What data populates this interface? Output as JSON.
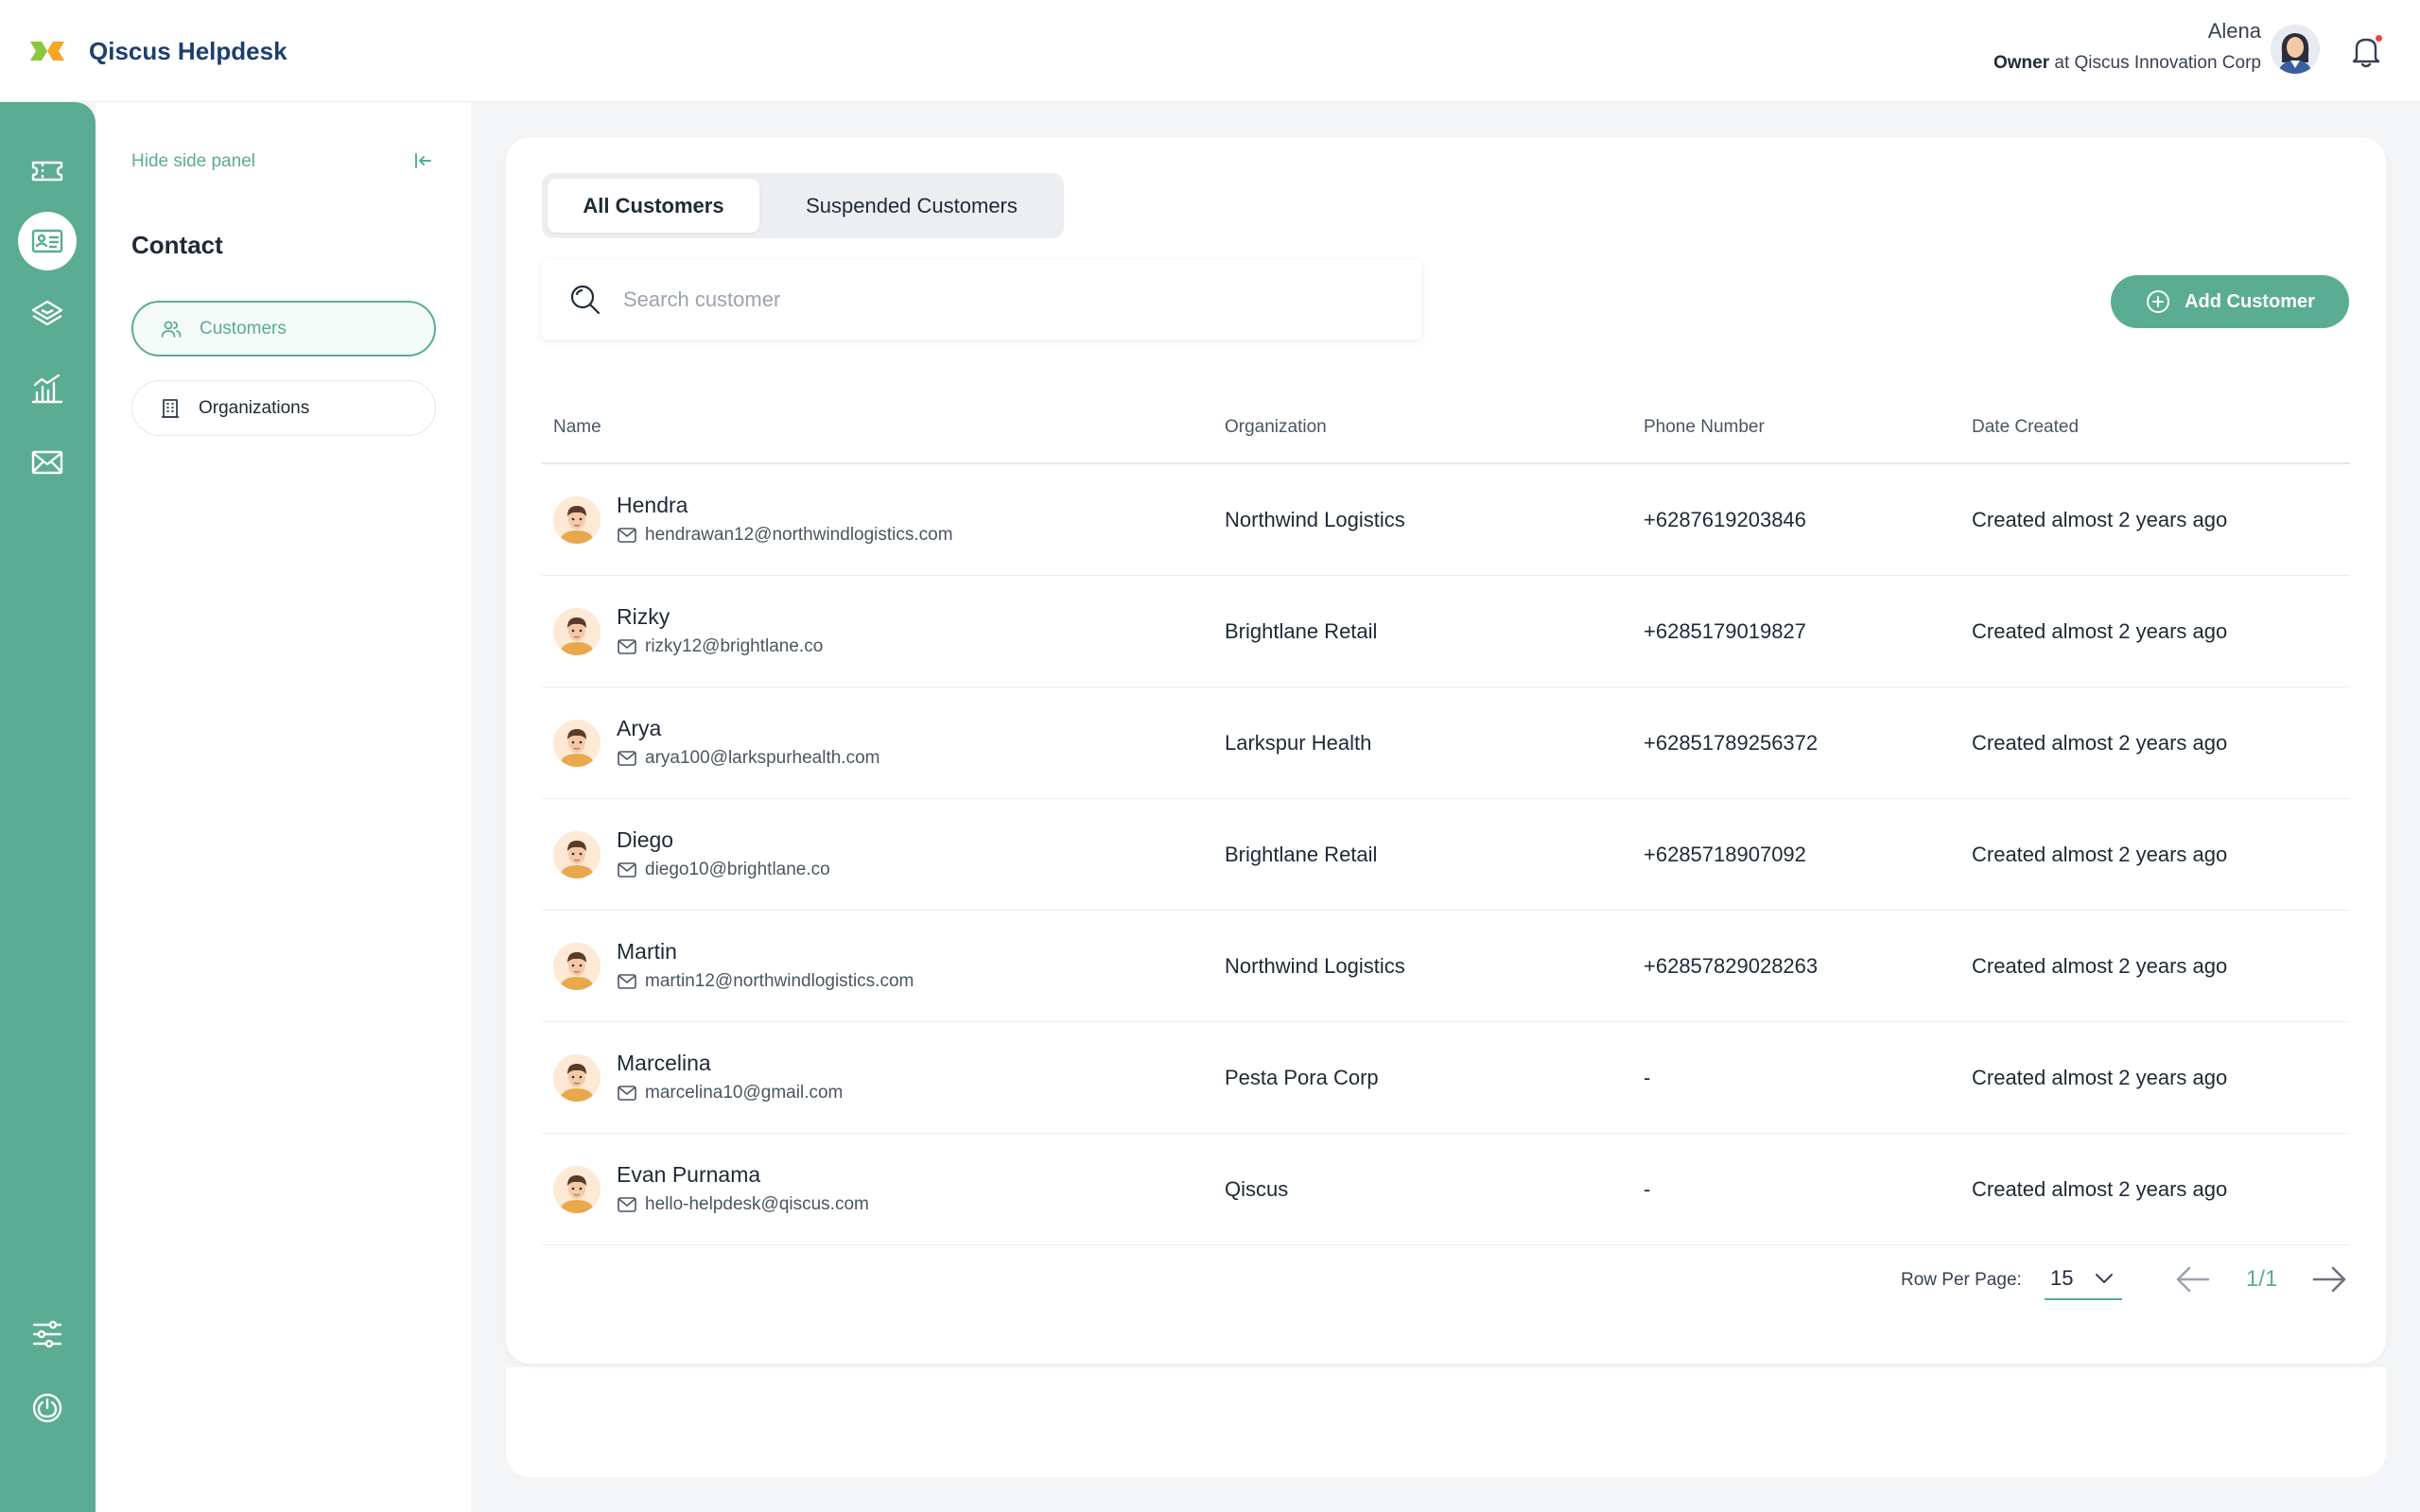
{
  "app": {
    "title": "Qiscus Helpdesk",
    "accent": "#5aac92",
    "brand_color": "#1c3f6e"
  },
  "user": {
    "name": "Alena",
    "role": "Owner",
    "role_joiner": " at ",
    "company": "Qiscus Innovation Corp"
  },
  "rail": {
    "items": [
      {
        "icon": "ticket-icon"
      },
      {
        "icon": "contact-card-icon",
        "active": true
      },
      {
        "icon": "layers-icon"
      },
      {
        "icon": "analytics-icon"
      },
      {
        "icon": "mail-icon"
      },
      {
        "icon": "settings-sliders-icon"
      },
      {
        "icon": "power-icon"
      }
    ]
  },
  "side_panel": {
    "hide_label": "Hide side panel",
    "title": "Contact",
    "items": [
      {
        "label": "Customers",
        "icon": "users-icon",
        "active": true
      },
      {
        "label": "Organizations",
        "icon": "building-icon",
        "active": false
      }
    ]
  },
  "tabs": [
    {
      "label": "All Customers",
      "active": true
    },
    {
      "label": "Suspended Customers",
      "active": false
    }
  ],
  "search": {
    "placeholder": "Search customer",
    "value": ""
  },
  "add_button": {
    "label": "Add Customer"
  },
  "table": {
    "columns": [
      "Name",
      "Organization",
      "Phone Number",
      "Date Created"
    ],
    "rows": [
      {
        "name": "Hendra",
        "email": "hendrawan12@northwindlogistics.com",
        "organization": "Northwind Logistics",
        "phone": "+6287619203846",
        "created": "Created almost 2 years ago"
      },
      {
        "name": "Rizky",
        "email": "rizky12@brightlane.co",
        "organization": "Brightlane Retail",
        "phone": "+6285179019827",
        "created": "Created almost 2 years ago"
      },
      {
        "name": "Arya",
        "email": "arya100@larkspurhealth.com",
        "organization": "Larkspur Health",
        "phone": "+62851789256372",
        "created": "Created almost 2 years ago"
      },
      {
        "name": "Diego",
        "email": "diego10@brightlane.co",
        "organization": "Brightlane Retail",
        "phone": "+6285718907092",
        "created": "Created almost 2 years ago"
      },
      {
        "name": "Martin",
        "email": "martin12@northwindlogistics.com",
        "organization": "Northwind Logistics",
        "phone": "+62857829028263",
        "created": "Created almost 2 years ago"
      },
      {
        "name": "Marcelina",
        "email": "marcelina10@gmail.com",
        "organization": "Pesta Pora Corp",
        "phone": "-",
        "created": "Created almost 2 years ago"
      },
      {
        "name": "Evan Purnama",
        "email": "hello-helpdesk@qiscus.com",
        "organization": "Qiscus",
        "phone": "-",
        "created": "Created almost 2 years ago"
      }
    ]
  },
  "pagination": {
    "rows_per_page_label": "Row Per Page:",
    "rows_per_page": "15",
    "page_indicator": "1/1"
  }
}
